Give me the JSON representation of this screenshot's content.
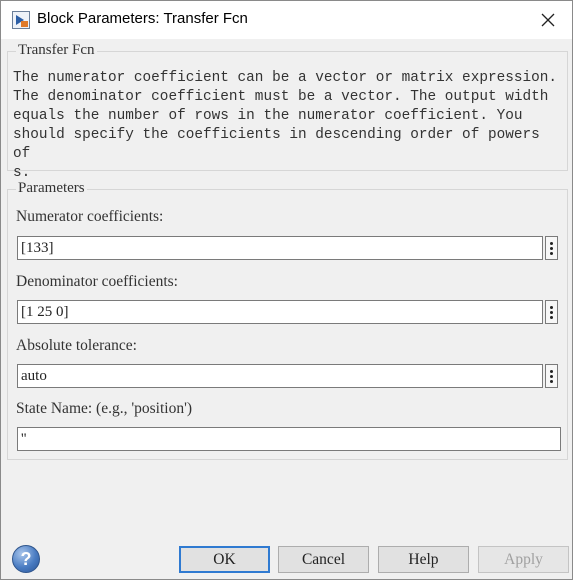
{
  "window": {
    "title": "Block Parameters: Transfer Fcn"
  },
  "transfer_group": {
    "title": "Transfer Fcn",
    "description": "The numerator coefficient can be a vector or matrix expression.\nThe denominator coefficient must be a vector. The output width\nequals the number of rows in the numerator coefficient. You\nshould specify the coefficients in descending order of powers of\ns."
  },
  "parameters_group": {
    "title": "Parameters",
    "fields": [
      {
        "label": "Numerator coefficients:",
        "value": "[133]"
      },
      {
        "label": "Denominator coefficients:",
        "value": "[1 25 0]"
      },
      {
        "label": "Absolute tolerance:",
        "value": "auto"
      },
      {
        "label": "State Name: (e.g., 'position')",
        "value": "''"
      }
    ]
  },
  "buttons": {
    "ok": "OK",
    "cancel": "Cancel",
    "help": "Help",
    "apply": "Apply"
  },
  "icons": {
    "app": "simulink-block-icon",
    "close": "close-icon",
    "help": "help-icon",
    "more": "more-options-icon"
  },
  "colors": {
    "default_button_border": "#2f7ad1",
    "help_icon": "#4a7cc2"
  }
}
